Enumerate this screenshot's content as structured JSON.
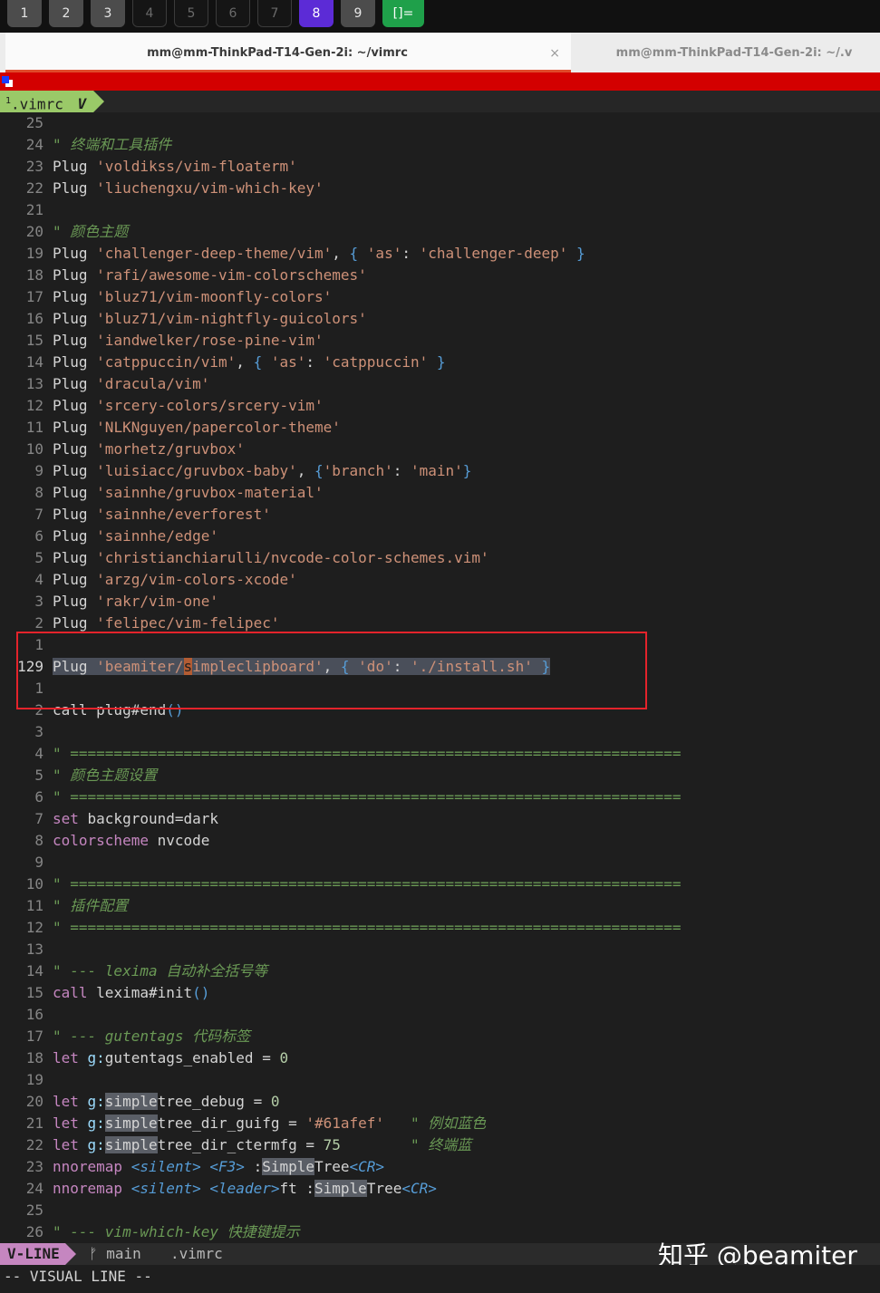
{
  "workspaces": [
    {
      "label": "1",
      "state": "used"
    },
    {
      "label": "2",
      "state": "used"
    },
    {
      "label": "3",
      "state": "used"
    },
    {
      "label": "4",
      "state": "empty"
    },
    {
      "label": "5",
      "state": "empty"
    },
    {
      "label": "6",
      "state": "empty"
    },
    {
      "label": "7",
      "state": "empty"
    },
    {
      "label": "8",
      "state": "active"
    },
    {
      "label": "9",
      "state": "used"
    },
    {
      "label": "[]=",
      "state": "layout"
    }
  ],
  "terminal_tabs": {
    "active_title": "mm@mm-ThinkPad-T14-Gen-2i: ~/vimrc",
    "close_glyph": "×",
    "inactive_title": "mm@mm-ThinkPad-T14-Gen-2i: ~/.v"
  },
  "vim_tabline": {
    "buffer_number": "1",
    "buffer_name": ".vimrc",
    "flag": "V"
  },
  "lines": [
    {
      "n": "25",
      "c": [
        [
          "",
          ""
        ]
      ]
    },
    {
      "n": "24",
      "c": [
        [
          "cm",
          "\" 终端和工具插件"
        ]
      ]
    },
    {
      "n": "23",
      "c": [
        [
          "kw",
          "Plug "
        ],
        [
          "st",
          "'voldikss/vim-floaterm'"
        ]
      ]
    },
    {
      "n": "22",
      "c": [
        [
          "kw",
          "Plug "
        ],
        [
          "st",
          "'liuchengxu/vim-which-key'"
        ]
      ]
    },
    {
      "n": "21",
      "c": [
        [
          "",
          ""
        ]
      ]
    },
    {
      "n": "20",
      "c": [
        [
          "cm",
          "\" 颜色主题"
        ]
      ]
    },
    {
      "n": "19",
      "c": [
        [
          "kw",
          "Plug "
        ],
        [
          "st",
          "'challenger-deep-theme/vim'"
        ],
        [
          "op",
          ", "
        ],
        [
          "br",
          "{ "
        ],
        [
          "st",
          "'as'"
        ],
        [
          "op",
          ": "
        ],
        [
          "st",
          "'challenger-deep'"
        ],
        [
          "br",
          " }"
        ]
      ]
    },
    {
      "n": "18",
      "c": [
        [
          "kw",
          "Plug "
        ],
        [
          "st",
          "'rafi/awesome-vim-colorschemes'"
        ]
      ]
    },
    {
      "n": "17",
      "c": [
        [
          "kw",
          "Plug "
        ],
        [
          "st",
          "'bluz71/vim-moonfly-colors'"
        ]
      ]
    },
    {
      "n": "16",
      "c": [
        [
          "kw",
          "Plug "
        ],
        [
          "st",
          "'bluz71/vim-nightfly-guicolors'"
        ]
      ]
    },
    {
      "n": "15",
      "c": [
        [
          "kw",
          "Plug "
        ],
        [
          "st",
          "'iandwelker/rose-pine-vim'"
        ]
      ]
    },
    {
      "n": "14",
      "c": [
        [
          "kw",
          "Plug "
        ],
        [
          "st",
          "'catppuccin/vim'"
        ],
        [
          "op",
          ", "
        ],
        [
          "br",
          "{ "
        ],
        [
          "st",
          "'as'"
        ],
        [
          "op",
          ": "
        ],
        [
          "st",
          "'catppuccin'"
        ],
        [
          "br",
          " }"
        ]
      ]
    },
    {
      "n": "13",
      "c": [
        [
          "kw",
          "Plug "
        ],
        [
          "st",
          "'dracula/vim'"
        ]
      ]
    },
    {
      "n": "12",
      "c": [
        [
          "kw",
          "Plug "
        ],
        [
          "st",
          "'srcery-colors/srcery-vim'"
        ]
      ]
    },
    {
      "n": "11",
      "c": [
        [
          "kw",
          "Plug "
        ],
        [
          "st",
          "'NLKNguyen/papercolor-theme'"
        ]
      ]
    },
    {
      "n": "10",
      "c": [
        [
          "kw",
          "Plug "
        ],
        [
          "st",
          "'morhetz/gruvbox'"
        ]
      ]
    },
    {
      "n": "9",
      "c": [
        [
          "kw",
          "Plug "
        ],
        [
          "st",
          "'luisiacc/gruvbox-baby'"
        ],
        [
          "op",
          ", "
        ],
        [
          "br",
          "{"
        ],
        [
          "st",
          "'branch'"
        ],
        [
          "op",
          ": "
        ],
        [
          "st",
          "'main'"
        ],
        [
          "br",
          "}"
        ]
      ]
    },
    {
      "n": "8",
      "c": [
        [
          "kw",
          "Plug "
        ],
        [
          "st",
          "'sainnhe/gruvbox-material'"
        ]
      ]
    },
    {
      "n": "7",
      "c": [
        [
          "kw",
          "Plug "
        ],
        [
          "st",
          "'sainnhe/everforest'"
        ]
      ]
    },
    {
      "n": "6",
      "c": [
        [
          "kw",
          "Plug "
        ],
        [
          "st",
          "'sainnhe/edge'"
        ]
      ]
    },
    {
      "n": "5",
      "c": [
        [
          "kw",
          "Plug "
        ],
        [
          "st",
          "'christianchiarulli/nvcode-color-schemes.vim'"
        ]
      ]
    },
    {
      "n": "4",
      "c": [
        [
          "kw",
          "Plug "
        ],
        [
          "st",
          "'arzg/vim-colors-xcode'"
        ]
      ]
    },
    {
      "n": "3",
      "c": [
        [
          "kw",
          "Plug "
        ],
        [
          "st",
          "'rakr/vim-one'"
        ]
      ]
    },
    {
      "n": "2",
      "c": [
        [
          "kw",
          "Plug "
        ],
        [
          "st",
          "'felipec/vim-felipec'"
        ]
      ]
    },
    {
      "n": "1",
      "c": [
        [
          "",
          ""
        ]
      ]
    },
    {
      "n": "129",
      "cur": true,
      "c": [
        [
          "kw sel",
          "Plug "
        ],
        [
          "st sel",
          "'beamiter/"
        ],
        [
          "cursor",
          "s"
        ],
        [
          "st sel",
          "impleclipboard'"
        ],
        [
          "op sel",
          ", "
        ],
        [
          "br sel",
          "{ "
        ],
        [
          "st sel",
          "'do'"
        ],
        [
          "op sel",
          ": "
        ],
        [
          "st sel",
          "'./install.sh'"
        ],
        [
          "br sel",
          " }"
        ]
      ]
    },
    {
      "n": "1",
      "c": [
        [
          "",
          ""
        ]
      ]
    },
    {
      "n": "2",
      "c": [
        [
          "kw",
          "call plug#end"
        ],
        [
          "br",
          "()"
        ]
      ]
    },
    {
      "n": "3",
      "c": [
        [
          "",
          ""
        ]
      ]
    },
    {
      "n": "4",
      "c": [
        [
          "cm",
          "\" ======================================================================"
        ]
      ]
    },
    {
      "n": "5",
      "c": [
        [
          "cm",
          "\" 颜色主题设置"
        ]
      ]
    },
    {
      "n": "6",
      "c": [
        [
          "cm",
          "\" ======================================================================"
        ]
      ]
    },
    {
      "n": "7",
      "c": [
        [
          "ky",
          "set "
        ],
        [
          "kw",
          "background"
        ],
        [
          "op",
          "="
        ],
        [
          "kw",
          "dark"
        ]
      ]
    },
    {
      "n": "8",
      "c": [
        [
          "ky",
          "colorscheme "
        ],
        [
          "kw",
          "nvcode"
        ]
      ]
    },
    {
      "n": "9",
      "c": [
        [
          "",
          ""
        ]
      ]
    },
    {
      "n": "10",
      "c": [
        [
          "cm",
          "\" ======================================================================"
        ]
      ]
    },
    {
      "n": "11",
      "c": [
        [
          "cm",
          "\" 插件配置"
        ]
      ]
    },
    {
      "n": "12",
      "c": [
        [
          "cm",
          "\" ======================================================================"
        ]
      ]
    },
    {
      "n": "13",
      "c": [
        [
          "",
          ""
        ]
      ]
    },
    {
      "n": "14",
      "c": [
        [
          "cm",
          "\" --- lexima 自动补全括号等"
        ]
      ]
    },
    {
      "n": "15",
      "c": [
        [
          "ky",
          "call "
        ],
        [
          "kw",
          "lexima#init"
        ],
        [
          "br",
          "()"
        ]
      ]
    },
    {
      "n": "16",
      "c": [
        [
          "",
          ""
        ]
      ]
    },
    {
      "n": "17",
      "c": [
        [
          "cm",
          "\" --- gutentags 代码标签"
        ]
      ]
    },
    {
      "n": "18",
      "c": [
        [
          "ky",
          "let "
        ],
        [
          "var",
          "g:"
        ],
        [
          "kw",
          "gutentags_enabled "
        ],
        [
          "op",
          "= "
        ],
        [
          "num",
          "0"
        ]
      ]
    },
    {
      "n": "19",
      "c": [
        [
          "",
          ""
        ]
      ]
    },
    {
      "n": "20",
      "c": [
        [
          "ky",
          "let "
        ],
        [
          "var",
          "g:"
        ],
        [
          "hl",
          "simple"
        ],
        [
          "kw",
          "tree_debug "
        ],
        [
          "op",
          "= "
        ],
        [
          "num",
          "0"
        ]
      ]
    },
    {
      "n": "21",
      "c": [
        [
          "ky",
          "let "
        ],
        [
          "var",
          "g:"
        ],
        [
          "hl",
          "simple"
        ],
        [
          "kw",
          "tree_dir_guifg "
        ],
        [
          "op",
          "= "
        ],
        [
          "st",
          "'#61afef'"
        ],
        [
          "kw",
          "   "
        ],
        [
          "cm",
          "\" 例如蓝色"
        ]
      ]
    },
    {
      "n": "22",
      "c": [
        [
          "ky",
          "let "
        ],
        [
          "var",
          "g:"
        ],
        [
          "hl",
          "simple"
        ],
        [
          "kw",
          "tree_dir_ctermfg "
        ],
        [
          "op",
          "= "
        ],
        [
          "num",
          "75"
        ],
        [
          "kw",
          "        "
        ],
        [
          "cm",
          "\" 终端蓝"
        ]
      ]
    },
    {
      "n": "23",
      "c": [
        [
          "ky",
          "nnoremap "
        ],
        [
          "sp",
          "<silent>"
        ],
        [
          "kw",
          " "
        ],
        [
          "sp",
          "<F3>"
        ],
        [
          "kw",
          " :"
        ],
        [
          "hl",
          "Simple"
        ],
        [
          "kw",
          "Tree"
        ],
        [
          "sp",
          "<CR>"
        ]
      ]
    },
    {
      "n": "24",
      "c": [
        [
          "ky",
          "nnoremap "
        ],
        [
          "sp",
          "<silent>"
        ],
        [
          "kw",
          " "
        ],
        [
          "sp",
          "<leader>"
        ],
        [
          "kw",
          "ft :"
        ],
        [
          "hl",
          "Simple"
        ],
        [
          "kw",
          "Tree"
        ],
        [
          "sp",
          "<CR>"
        ]
      ]
    },
    {
      "n": "25",
      "c": [
        [
          "",
          ""
        ]
      ]
    },
    {
      "n": "26",
      "c": [
        [
          "cm",
          "\" --- vim-which-key 快捷键提示"
        ]
      ]
    }
  ],
  "statusline": {
    "mode": "V-LINE",
    "branch": "ᚠ main",
    "file": ".vimrc"
  },
  "watermark": "知乎 @beamiter",
  "cmdline": "-- VISUAL LINE --"
}
